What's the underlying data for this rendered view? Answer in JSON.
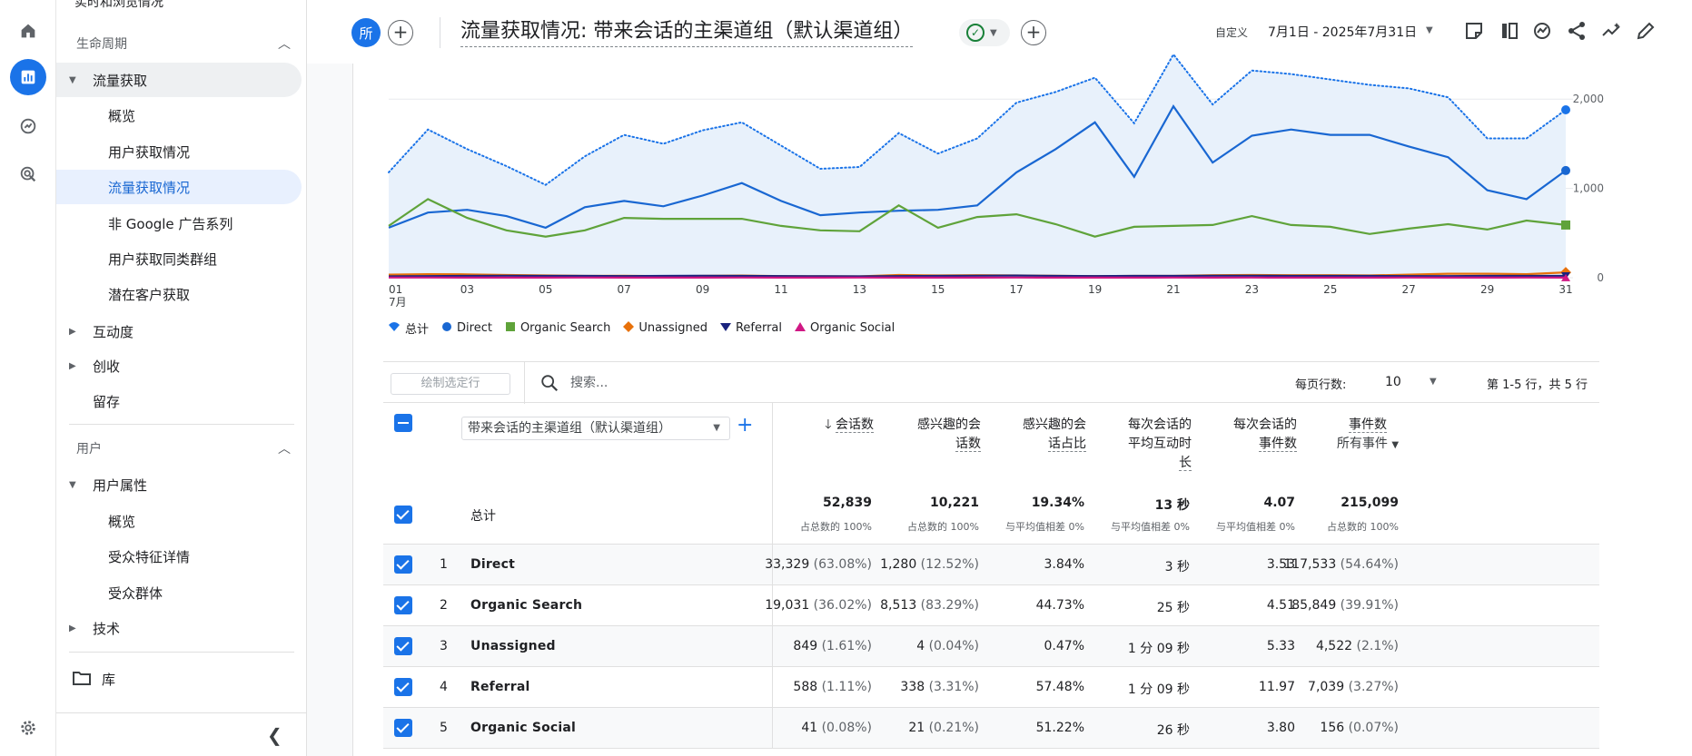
{
  "nav": {
    "cut_top": "实时和浏览情况",
    "section_lifecycle": "生命周期",
    "acquisition": "流量获取",
    "acq_items": [
      "概览",
      "用户获取情况",
      "流量获取情况",
      "非 Google 广告系列",
      "用户获取同类群组",
      "潜在客户获取"
    ],
    "engagement": "互动度",
    "monetization": "创收",
    "retention": "留存",
    "section_user": "用户",
    "user_attributes": "用户属性",
    "user_items": [
      "概览",
      "受众特征详情",
      "受众群体"
    ],
    "tech": "技术",
    "library": "库"
  },
  "header": {
    "badge": "所",
    "title": "流量获取情况: 带来会话的主渠道组（默认渠道组）",
    "date_label": "自定义",
    "date_range": "7月1日 - 2025年7月31日"
  },
  "chart_data": {
    "type": "line",
    "x": [
      "01",
      "02",
      "03",
      "04",
      "05",
      "06",
      "07",
      "08",
      "09",
      "10",
      "11",
      "12",
      "13",
      "14",
      "15",
      "16",
      "17",
      "18",
      "19",
      "20",
      "21",
      "22",
      "23",
      "24",
      "25",
      "26",
      "27",
      "28",
      "29",
      "30",
      "31"
    ],
    "x_tick_labels": [
      "01",
      "03",
      "05",
      "07",
      "09",
      "11",
      "13",
      "15",
      "17",
      "19",
      "21",
      "23",
      "25",
      "27",
      "29",
      "31"
    ],
    "x_month_label": "7月",
    "y_ticks": [
      "0",
      "1,000",
      "2,000"
    ],
    "ylim": [
      0,
      2500
    ],
    "legend_position": "bottom-left",
    "series": [
      {
        "name": "总计",
        "color": "#1a73e8",
        "style": "dotted-area",
        "values": [
          1180,
          1660,
          1440,
          1250,
          1040,
          1360,
          1600,
          1500,
          1650,
          1740,
          1480,
          1220,
          1240,
          1620,
          1390,
          1560,
          1960,
          2080,
          2240,
          1730,
          2530,
          1940,
          2320,
          2280,
          2220,
          2160,
          2120,
          2020,
          1560,
          1560,
          1880
        ]
      },
      {
        "name": "Direct",
        "color": "#1967d2",
        "style": "line",
        "values": [
          560,
          730,
          760,
          690,
          560,
          790,
          860,
          800,
          920,
          1060,
          860,
          700,
          730,
          750,
          760,
          810,
          1180,
          1440,
          1740,
          1130,
          1920,
          1290,
          1590,
          1660,
          1600,
          1600,
          1470,
          1350,
          980,
          880,
          1200
        ]
      },
      {
        "name": "Organic Search",
        "color": "#5fa33a",
        "style": "line",
        "values": [
          580,
          880,
          670,
          530,
          460,
          530,
          670,
          660,
          660,
          660,
          580,
          530,
          520,
          810,
          560,
          680,
          710,
          600,
          460,
          570,
          580,
          590,
          690,
          590,
          570,
          490,
          550,
          600,
          540,
          640,
          590
        ]
      },
      {
        "name": "Unassigned",
        "color": "#e8710a",
        "style": "line",
        "values": [
          35,
          40,
          38,
          30,
          25,
          20,
          22,
          18,
          20,
          24,
          18,
          16,
          15,
          30,
          25,
          28,
          25,
          22,
          18,
          20,
          20,
          28,
          30,
          28,
          28,
          25,
          35,
          45,
          45,
          40,
          60
        ]
      },
      {
        "name": "Referral",
        "color": "#1a237e",
        "style": "line",
        "values": [
          15,
          18,
          20,
          22,
          20,
          20,
          18,
          20,
          22,
          20,
          18,
          16,
          15,
          18,
          20,
          22,
          24,
          20,
          18,
          20,
          20,
          22,
          22,
          20,
          20,
          20,
          18,
          18,
          20,
          20,
          20
        ]
      },
      {
        "name": "Organic Social",
        "color": "#d01884",
        "style": "line",
        "values": [
          2,
          2,
          1,
          1,
          1,
          2,
          1,
          1,
          1,
          2,
          1,
          1,
          2,
          1,
          1,
          1,
          2,
          1,
          1,
          1,
          2,
          1,
          2,
          1,
          1,
          1,
          2,
          1,
          1,
          2,
          1
        ]
      }
    ]
  },
  "table": {
    "plot_rows_btn": "绘制选定行",
    "search_placeholder": "搜索...",
    "rows_per_page_label": "每页行数:",
    "rows_per_page_value": "10",
    "page_info": "第 1-5 行，共 5 行",
    "dimension": "带来会话的主渠道组（默认渠道组）",
    "columns": [
      {
        "l1": "会话数",
        "l2": "",
        "l3": "",
        "l4": ""
      },
      {
        "l1": "感兴趣的会",
        "l2": "话数",
        "l3": "",
        "l4": ""
      },
      {
        "l1": "感兴趣的会",
        "l2": "话占比",
        "l3": "",
        "l4": ""
      },
      {
        "l1": "每次会话的",
        "l2": "平均互动时",
        "l3": "长",
        "l4": ""
      },
      {
        "l1": "每次会话的",
        "l2": "事件数",
        "l3": "",
        "l4": ""
      },
      {
        "l1": "事件数",
        "l2": "所有事件",
        "l3": "",
        "l4": ""
      }
    ],
    "totals": {
      "label": "总计",
      "values": [
        "52,839",
        "10,221",
        "19.34%",
        "13 秒",
        "4.07",
        "215,099"
      ],
      "subs": [
        "占总数的 100%",
        "占总数的 100%",
        "与平均值相差 0%",
        "与平均值相差 0%",
        "与平均值相差 0%",
        "占总数的 100%"
      ]
    },
    "rows": [
      {
        "idx": "1",
        "name": "Direct",
        "c": [
          [
            "33,329",
            "(63.08%)"
          ],
          [
            "1,280",
            "(12.52%)"
          ],
          [
            "3.84%",
            ""
          ],
          [
            "3 秒",
            ""
          ],
          [
            "3.53",
            ""
          ],
          [
            "117,533",
            "(54.64%)"
          ]
        ]
      },
      {
        "idx": "2",
        "name": "Organic Search",
        "c": [
          [
            "19,031",
            "(36.02%)"
          ],
          [
            "8,513",
            "(83.29%)"
          ],
          [
            "44.73%",
            ""
          ],
          [
            "25 秒",
            ""
          ],
          [
            "4.51",
            ""
          ],
          [
            "85,849",
            "(39.91%)"
          ]
        ]
      },
      {
        "idx": "3",
        "name": "Unassigned",
        "c": [
          [
            "849",
            "(1.61%)"
          ],
          [
            "4",
            "(0.04%)"
          ],
          [
            "0.47%",
            ""
          ],
          [
            "1 分 09 秒",
            ""
          ],
          [
            "5.33",
            ""
          ],
          [
            "4,522",
            "(2.1%)"
          ]
        ]
      },
      {
        "idx": "4",
        "name": "Referral",
        "c": [
          [
            "588",
            "(1.11%)"
          ],
          [
            "338",
            "(3.31%)"
          ],
          [
            "57.48%",
            ""
          ],
          [
            "1 分 09 秒",
            ""
          ],
          [
            "11.97",
            ""
          ],
          [
            "7,039",
            "(3.27%)"
          ]
        ]
      },
      {
        "idx": "5",
        "name": "Organic Social",
        "c": [
          [
            "41",
            "(0.08%)"
          ],
          [
            "21",
            "(0.21%)"
          ],
          [
            "51.22%",
            ""
          ],
          [
            "26 秒",
            ""
          ],
          [
            "3.80",
            ""
          ],
          [
            "156",
            "(0.07%)"
          ]
        ]
      }
    ]
  }
}
